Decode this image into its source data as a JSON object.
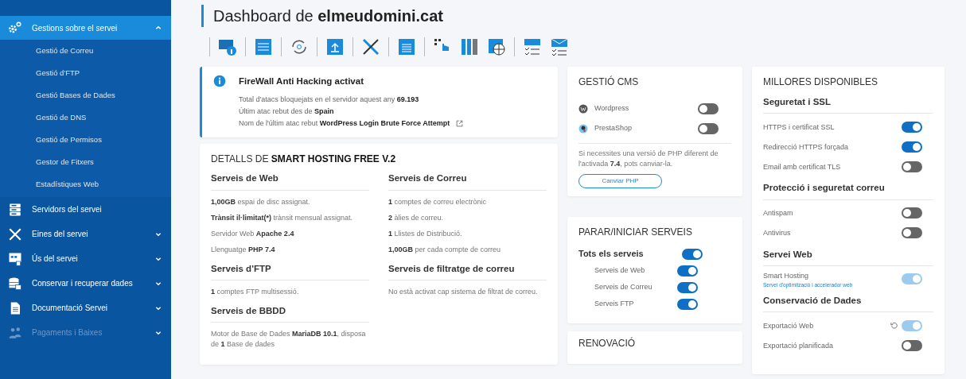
{
  "sidebar": {
    "items": [
      {
        "label": "Gestions sobre el servei",
        "selected": true,
        "expandable": true,
        "expanded": true,
        "disabled": false,
        "children": [
          {
            "label": "Gestió de Correu"
          },
          {
            "label": "Gestió d'FTP"
          },
          {
            "label": "Gestió Bases de Dades"
          },
          {
            "label": "Gestió de DNS"
          },
          {
            "label": "Gestió de Permisos"
          },
          {
            "label": "Gestor de Fitxers"
          },
          {
            "label": "Estadístiques Web"
          }
        ]
      },
      {
        "label": "Servidors del servei",
        "selected": false,
        "expandable": false,
        "expanded": false,
        "disabled": false
      },
      {
        "label": "Eines del servei",
        "selected": false,
        "expandable": true,
        "expanded": false,
        "disabled": false
      },
      {
        "label": "Ús del servei",
        "selected": false,
        "expandable": true,
        "expanded": false,
        "disabled": false
      },
      {
        "label": "Conservar i recuperar dades",
        "selected": false,
        "expandable": true,
        "expanded": false,
        "disabled": false
      },
      {
        "label": "Documentació Servei",
        "selected": false,
        "expandable": true,
        "expanded": false,
        "disabled": false
      },
      {
        "label": "Pagaments i Baixes",
        "selected": false,
        "expandable": true,
        "expanded": false,
        "disabled": true
      }
    ]
  },
  "page_title": "Dashboard de **elmeudomini.cat**",
  "firewall": {
    "title": "FireWall Anti Hacking activat",
    "lines": [
      {
        "text": "Total d'atacs bloquejats en el servidor aquest any  **69.193**",
        "link": false
      },
      {
        "text": "Últim atac rebut des de  **Spain**",
        "link": false
      },
      {
        "text": "Nom de l'últim atac rebut  **WordPress Login Brute Force Attempt**",
        "link": true
      }
    ]
  },
  "details": {
    "title": "DETALLS DE **SMART HOSTING FREE V.2**",
    "columns": [
      [
        {
          "title": "Serveis de Web",
          "lines": [
            "**1,00GB** espai de disc assignat.",
            "**Trànsit il·limitat(*)** trànsit mensual assignat.",
            "Servidor Web **Apache 2.4**",
            "Llenguatge **PHP 7.4**"
          ]
        },
        {
          "title": "Serveis d'FTP",
          "lines": [
            "**1** comptes FTP multisessió."
          ]
        },
        {
          "title": "Serveis de BBDD",
          "lines": [
            "Motor de Base de Dades **MariaDB 10.1**, disposa de **1** Base de dades"
          ]
        }
      ],
      [
        {
          "title": "Serveis de Correu",
          "lines": [
            "**1** comptes de correu electrònic",
            "**2** àlies de correu.",
            "**1** Llistes de Distribució.",
            "**1,00GB** per cada compte de correu"
          ]
        },
        {
          "title": "Serveis de filtratge de correu",
          "lines": [
            "No està activat cap sistema de filtrat de correu."
          ]
        }
      ]
    ]
  },
  "cms": {
    "title": "GESTIÓ CMS",
    "items": [
      {
        "label": "Wordpress",
        "on": false
      },
      {
        "label": "PrestaShop",
        "on": false
      }
    ],
    "note": "Si necessites una versió de PHP diferent de l'activada **7.4**, pots canviar-la.",
    "button": "Canviar PHP"
  },
  "services": {
    "title": "PARAR/INICIAR SERVEIS",
    "items": [
      {
        "label": "Tots els serveis",
        "kind": "main",
        "on": true
      },
      {
        "label": "Serveis de Web",
        "kind": "sub",
        "on": true
      },
      {
        "label": "Serveis de Correu",
        "kind": "sub",
        "on": true
      },
      {
        "label": "Serveis FTP",
        "kind": "sub",
        "on": true
      }
    ]
  },
  "renewal": {
    "title": "RENOVACIÓ"
  },
  "upgrades": {
    "title": "MILLORES DISPONIBLES",
    "sections": [
      {
        "title": "Seguretat i SSL",
        "rows": [
          {
            "label": "HTTPS i certificat SSL",
            "on": true,
            "disabled": false,
            "reset": false
          },
          {
            "label": "Redirecció HTTPS forçada",
            "on": true,
            "disabled": false,
            "reset": false
          },
          {
            "label": "Email amb certificat TLS",
            "on": false,
            "disabled": false,
            "reset": false
          }
        ]
      },
      {
        "title": "Protecció i seguretat correu",
        "rows": [
          {
            "label": "Antispam",
            "on": false,
            "disabled": false,
            "reset": false
          },
          {
            "label": "Antivirus",
            "on": false,
            "disabled": false,
            "reset": false
          }
        ]
      },
      {
        "title": "Servei Web",
        "rows": [
          {
            "label": "Smart Hosting",
            "sublabel": "Servei d'optimització i accelerador web",
            "on": true,
            "disabled": true,
            "reset": false
          }
        ]
      },
      {
        "title": "Conservació de Dades",
        "rows": [
          {
            "label": "Exportació Web",
            "on": true,
            "disabled": true,
            "reset": true
          },
          {
            "label": "Exportació planificada",
            "on": false,
            "disabled": false,
            "reset": false
          }
        ]
      }
    ]
  }
}
